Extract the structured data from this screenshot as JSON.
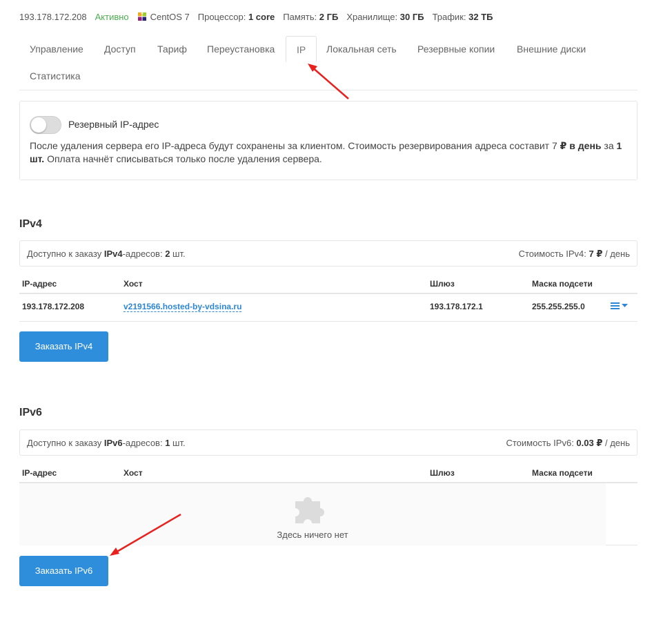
{
  "server": {
    "ip": "193.178.172.208",
    "status": "Активно",
    "os": "CentOS 7",
    "specs": [
      {
        "label": "Процессор:",
        "value": "1 core"
      },
      {
        "label": "Память:",
        "value": "2 ГБ"
      },
      {
        "label": "Хранилище:",
        "value": "30 ГБ"
      },
      {
        "label": "Трафик:",
        "value": "32 ТБ"
      }
    ]
  },
  "tabs": [
    {
      "label": "Управление"
    },
    {
      "label": "Доступ"
    },
    {
      "label": "Тариф"
    },
    {
      "label": "Переустановка"
    },
    {
      "label": "IP"
    },
    {
      "label": "Локальная сеть"
    },
    {
      "label": "Резервные копии"
    },
    {
      "label": "Внешние диски"
    },
    {
      "label": "Статистика"
    }
  ],
  "active_tab": "IP",
  "reserve": {
    "label": "Резервный IP-адрес",
    "desc_1": "После удаления сервера его IP-адреса будут сохранены за клиентом. Стоимость резервирования адреса составит 7 ",
    "desc_price": "₽ в день",
    "desc_2": " за ",
    "desc_qty": "1 шт.",
    "desc_3": " Оплата начнёт списываться только после удаления сервера.",
    "enabled": false
  },
  "ipv4": {
    "title": "IPv4",
    "avail_prefix": "Доступно к заказу ",
    "avail_kind": "IPv4",
    "avail_mid": "-адресов: ",
    "avail_count": "2",
    "avail_suffix": " шт.",
    "cost_prefix": "Стоимость IPv4: ",
    "cost_value": "7 ₽",
    "cost_suffix": " / день",
    "columns": [
      "IP-адрес",
      "Хост",
      "Шлюз",
      "Маска подсети"
    ],
    "rows": [
      {
        "ip": "193.178.172.208",
        "host": "v2191566.hosted-by-vdsina.ru",
        "gateway": "193.178.172.1",
        "mask": "255.255.255.0"
      }
    ],
    "order_button": "Заказать IPv4"
  },
  "ipv6": {
    "title": "IPv6",
    "avail_prefix": "Доступно к заказу ",
    "avail_kind": "IPv6",
    "avail_mid": "-адресов: ",
    "avail_count": "1",
    "avail_suffix": " шт.",
    "cost_prefix": "Стоимость IPv6: ",
    "cost_value": "0.03 ₽",
    "cost_suffix": " / день",
    "columns": [
      "IP-адрес",
      "Хост",
      "Шлюз",
      "Маска подсети"
    ],
    "empty_text": "Здесь ничего нет",
    "order_button": "Заказать IPv6"
  },
  "colors": {
    "accent": "#2f8edc",
    "status_active": "#4caf50",
    "link": "#2e87d6",
    "annotation_arrow": "#e8201e"
  },
  "icons": [
    "centos-icon",
    "hamburger-menu-icon",
    "caret-down-icon",
    "puzzle-icon"
  ]
}
